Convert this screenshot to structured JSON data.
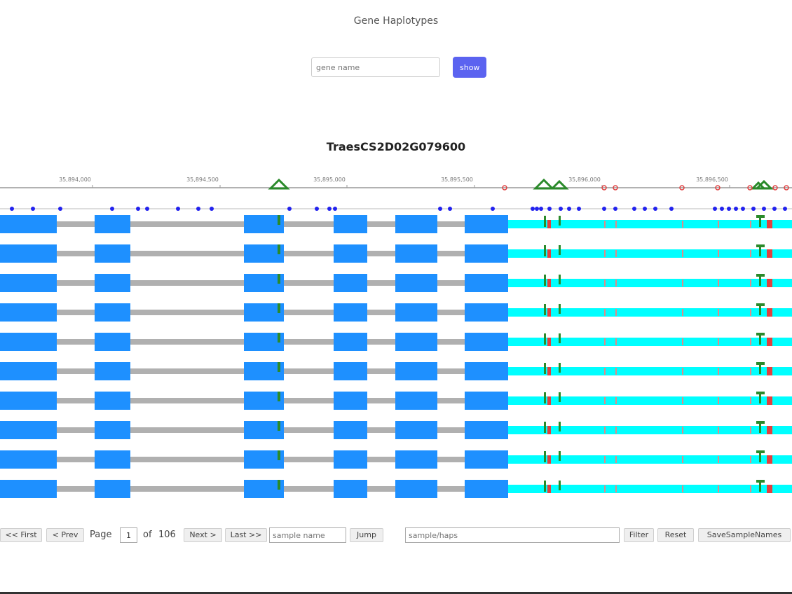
{
  "page": {
    "title": "Gene Haplotypes"
  },
  "search": {
    "placeholder": "gene name",
    "button_label": "show"
  },
  "gene": {
    "id": "TraesCS2D02G079600",
    "axis_ticks": [
      "35,894,000",
      "35,894,500",
      "35,895,000",
      "35,895,500",
      "35,896,000",
      "35,896,500"
    ],
    "haplotype_rows": 10
  },
  "pagination": {
    "first_label": "<< First",
    "prev_label": "< Prev",
    "page_label": "Page",
    "current_page": "1",
    "of_label": "of",
    "total_pages": "106",
    "next_label": "Next >",
    "last_label": "Last >>",
    "sample_placeholder": "sample name",
    "jump_label": "Jump",
    "filter_placeholder": "sample/haps",
    "filter_label": "Filter",
    "reset_label": "Reset",
    "save_label": "SaveSampleNames"
  },
  "colors": {
    "exon": "#1e90ff",
    "utr": "#00ffff",
    "intron": "#b0b0b0",
    "snp_marker": "#2222ee",
    "indel_marker": "#2a8a2a",
    "deletion_marker": "#e04040",
    "button_accent": "#5b63f0"
  }
}
